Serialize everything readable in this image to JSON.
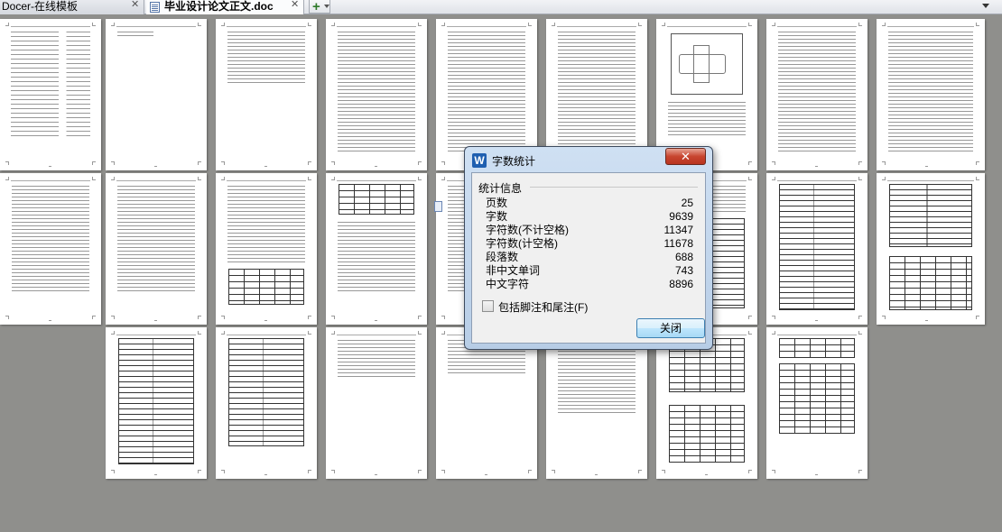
{
  "tabs": [
    {
      "label": "Docer-在线模板"
    },
    {
      "label": "毕业设计论文正文.doc"
    }
  ],
  "dialog": {
    "title": "字数统计",
    "close_glyph": "✕",
    "group_label": "统计信息",
    "stats": [
      {
        "label": "页数",
        "value": "25"
      },
      {
        "label": "字数",
        "value": "9639"
      },
      {
        "label": "字符数(不计空格)",
        "value": "11347"
      },
      {
        "label": "字符数(计空格)",
        "value": "11678"
      },
      {
        "label": "段落数",
        "value": "688"
      },
      {
        "label": "非中文单词",
        "value": "743"
      },
      {
        "label": "中文字符",
        "value": "8896"
      }
    ],
    "checkbox_label": "包括脚注和尾注(F)",
    "checkbox_checked": false,
    "close_button_label": "关闭"
  },
  "page_count_shown": 25,
  "colors": {
    "background": "#8f8f8c",
    "dialog_frame": "#b7cde6",
    "close_red": "#c7452f",
    "button_blue": "#bee6fd"
  }
}
